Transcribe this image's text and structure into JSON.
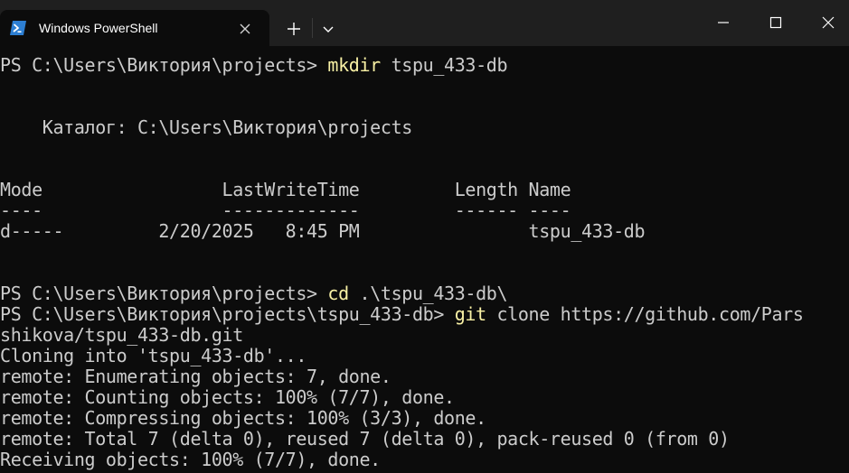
{
  "window": {
    "tab_title": "Windows PowerShell",
    "tab_icon": "powershell-icon",
    "new_tab_icon": "plus-icon",
    "dropdown_icon": "chevron-down-icon",
    "minimize_icon": "minimize-icon",
    "maximize_icon": "maximize-icon",
    "close_icon": "close-icon"
  },
  "colors": {
    "background": "#0c0c0c",
    "titlebar": "#1f1f1f",
    "text": "#cccccc",
    "command": "#f9f1a5"
  },
  "terminal": {
    "prompt1": "PS C:\\Users\\Виктория\\projects> ",
    "cmd1": "mkdir",
    "args1": " tspu_433-db",
    "catalog": "    Каталог: C:\\Users\\Виктория\\projects",
    "header": "Mode                 LastWriteTime         Length Name",
    "underline": "----                 -------------         ------ ----",
    "row": "d-----         2/20/2025   8:45 PM                tspu_433-db",
    "prompt2": "PS C:\\Users\\Виктория\\projects> ",
    "cmd2": "cd",
    "args2": " .\\tspu_433-db\\",
    "prompt3": "PS C:\\Users\\Виктория\\projects\\tspu_433-db> ",
    "cmd3": "git",
    "args3": " clone https://github.com/Pars",
    "wrap3": "shikova/tspu_433-db.git",
    "out1": "Cloning into 'tspu_433-db'...",
    "out2": "remote: Enumerating objects: 7, done.",
    "out3": "remote: Counting objects: 100% (7/7), done.",
    "out4": "remote: Compressing objects: 100% (3/3), done.",
    "out5": "remote: Total 7 (delta 0), reused 7 (delta 0), pack-reused 0 (from 0)",
    "out6": "Receiving objects: 100% (7/7), done."
  }
}
